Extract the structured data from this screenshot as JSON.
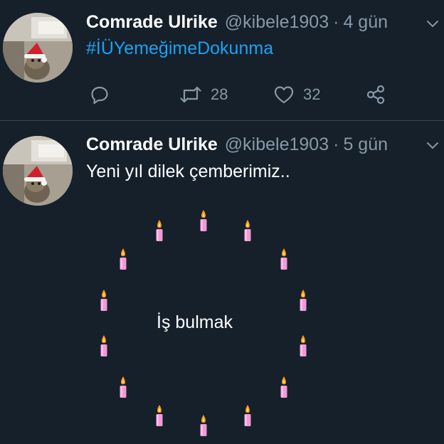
{
  "colors": {
    "background": "#15202b",
    "secondary_text": "#8899a6",
    "hashtag": "#1da1f2",
    "divider": "#38444d",
    "candle_body": "#f19ad8",
    "candle_flame": "#ff9a1a"
  },
  "tweets": [
    {
      "avatar_icon": "cat-with-santa-hat-avatar",
      "display_name": "Comrade Ulrike",
      "handle": "@kibele1903",
      "separator": "·",
      "time": "4 gün",
      "text": "#İÜYemeğimeDokunma",
      "actions": {
        "reply_icon": "reply-icon",
        "retweet_icon": "retweet-icon",
        "retweet_count": "28",
        "like_icon": "heart-icon",
        "like_count": "32",
        "share_icon": "share-icon"
      }
    },
    {
      "avatar_icon": "cat-with-santa-hat-avatar",
      "display_name": "Comrade Ulrike",
      "handle": "@kibele1903",
      "separator": "·",
      "time": "5 gün",
      "text": "Yeni yıl dilek çemberimiz..",
      "circle_center_text": "İş bulmak",
      "candle_icon": "candle-emoji",
      "candle_count": 14
    }
  ]
}
